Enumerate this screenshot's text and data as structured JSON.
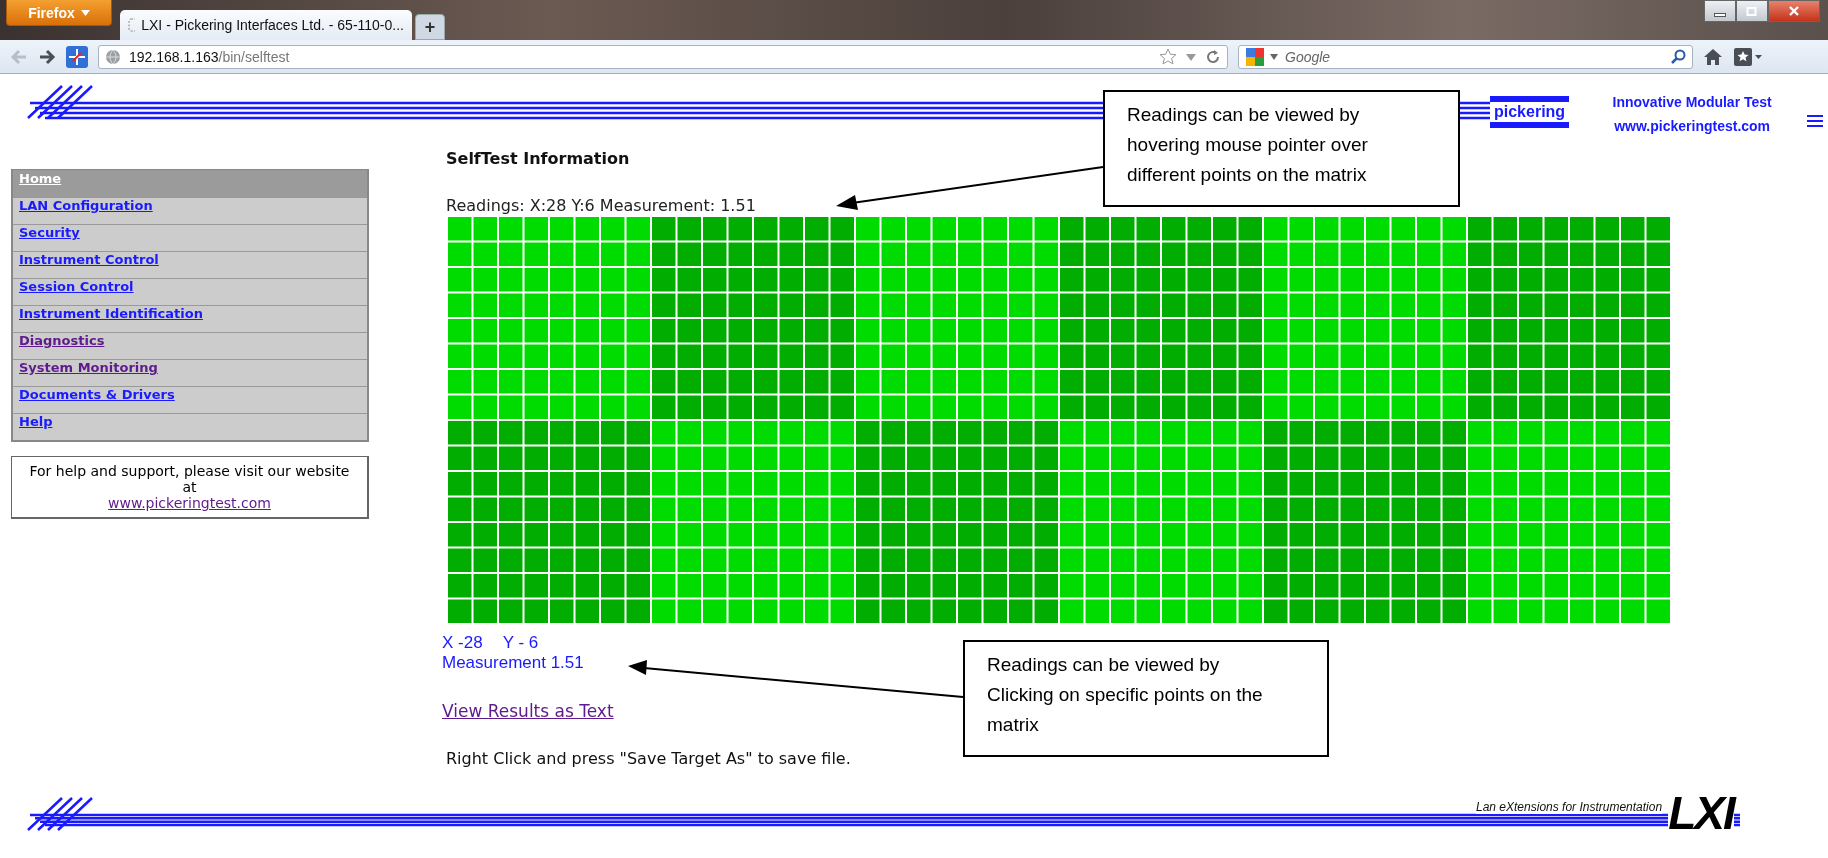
{
  "browser": {
    "app_button": "Firefox",
    "tab": {
      "title": "LXI - Pickering Interfaces Ltd. - 65-110-0..."
    },
    "new_tab": "+",
    "address": {
      "host": "192.168.1.163",
      "path": "/bin/selftest"
    },
    "search": {
      "placeholder": "Google"
    }
  },
  "header": {
    "brand": "pickering",
    "tagline": "Innovative Modular Test",
    "website": "www.pickeringtest.com"
  },
  "sidebar": {
    "items": [
      {
        "label": "Home",
        "selected": true,
        "visited": false
      },
      {
        "label": "LAN Configuration",
        "selected": false,
        "visited": false
      },
      {
        "label": "Security",
        "selected": false,
        "visited": false
      },
      {
        "label": "Instrument Control",
        "selected": false,
        "visited": false
      },
      {
        "label": "Session Control",
        "selected": false,
        "visited": false
      },
      {
        "label": "Instrument Identification",
        "selected": false,
        "visited": false
      },
      {
        "label": "Diagnostics",
        "selected": false,
        "visited": true
      },
      {
        "label": "System Monitoring",
        "selected": false,
        "visited": true
      },
      {
        "label": "Documents & Drivers",
        "selected": false,
        "visited": false
      },
      {
        "label": "Help",
        "selected": false,
        "visited": false
      }
    ]
  },
  "support": {
    "text": "For help and support, please visit our website at",
    "link": "www.pickeringtest.com"
  },
  "main": {
    "title": "SelfTest Information",
    "readings": "Readings: X:28 Y:6 Measurement: 1.51",
    "clicked": {
      "x": "X -28",
      "y": "Y - 6",
      "measurement": "Measurement 1.51"
    },
    "results_link": "View Results as Text",
    "note": "Right Click and press \"Save Target As\" to save file."
  },
  "footer": {
    "caption": "Lan eXtensions for Instrumentation",
    "logo": "LXI"
  },
  "callouts": [
    {
      "text": "Readings can be viewed by hovering mouse pointer over different points on the matrix"
    },
    {
      "text": "Readings can be viewed by Clicking on specific points on the matrix"
    }
  ]
}
